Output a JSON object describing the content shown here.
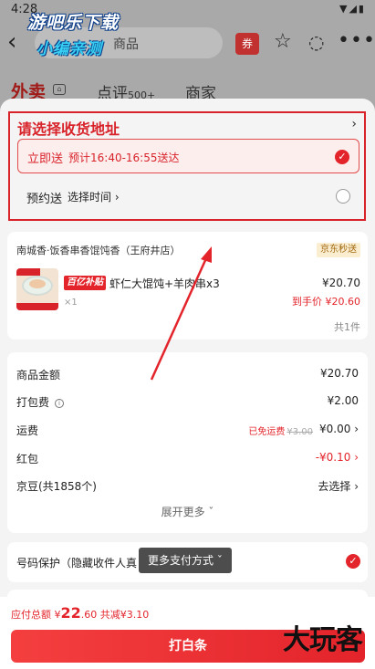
{
  "status_bar": {
    "time": "4:28",
    "icons": "▼◢▮"
  },
  "watermark_top": {
    "line1": "游吧乐下载",
    "line2": "小编亲测"
  },
  "watermark_bottom": "大玩客",
  "header": {
    "search_text": "商品",
    "coupon_label": "券"
  },
  "bg_tabs": {
    "takeout": "外卖",
    "review": "点评",
    "review_count": "500+",
    "shop": "商家"
  },
  "address": {
    "title": "请选择收货地址",
    "instant_label": "立即送",
    "instant_eta": "预计16:40-16:55送达",
    "scheduled_label": "预约送",
    "scheduled_action": "选择时间 ›"
  },
  "store": {
    "name": "南城香·饭香串香馄饨香（王府井店）",
    "tag": "京东秒送",
    "item": {
      "subsidy_tag": "百亿补贴",
      "name": "虾仁大馄饨+羊肉串x3",
      "quantity": "×1",
      "price": "¥20.70",
      "final_price": "到手价 ¥20.60"
    },
    "item_count": "共1件"
  },
  "fees": [
    {
      "label": "商品金额",
      "value": "¥20.70"
    },
    {
      "label": "打包费",
      "value": "¥2.00"
    },
    {
      "label": "运费",
      "hint": "已免运费",
      "original": "¥3.00",
      "value": "¥0.00 ›"
    },
    {
      "label": "红包",
      "value": "-¥0.10 ›"
    },
    {
      "label": "京豆(共1858个)",
      "value": "去选择 ›"
    }
  ],
  "expand_label": "展开更多 ˇ",
  "phone_protection": "号码保护（隐藏收件人真",
  "pay_methods_popup": "更多支付方式 ˇ",
  "footer": {
    "total_prefix": "应付总额 ¥",
    "total_amount": "22",
    "total_decimal": ".60",
    "discount": "共减¥3.10",
    "pay_button": "打白条"
  },
  "colors": {
    "accent": "#e3242b",
    "highlight_box": "#d8232a"
  }
}
